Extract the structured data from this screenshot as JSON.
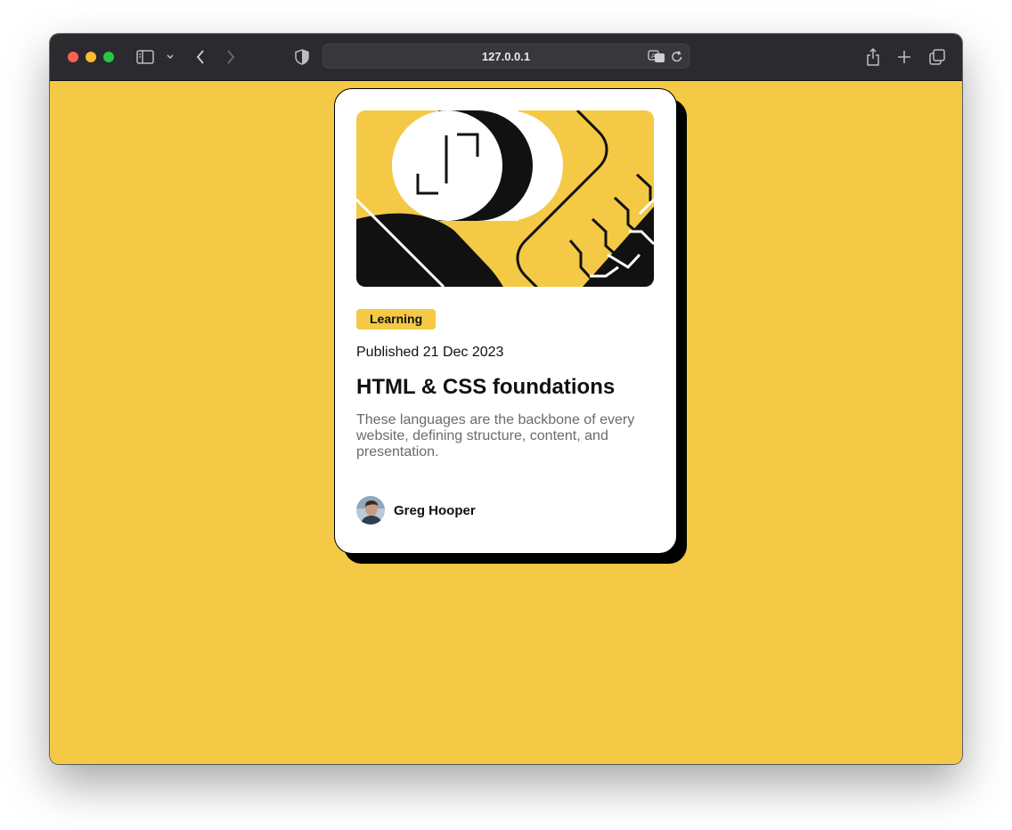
{
  "browser": {
    "url": "127.0.0.1"
  },
  "card": {
    "category": "Learning",
    "published": "Published 21 Dec 2023",
    "title": "HTML & CSS foundations",
    "description": "These languages are the backbone of every website, defining structure, content, and presentation.",
    "author": "Greg Hooper"
  },
  "colors": {
    "page_background": "#f4c945",
    "card_background": "#ffffff",
    "text_dark": "#111111",
    "text_muted": "#6b6b6b",
    "toolbar": "#2b2a2e"
  },
  "icons": {
    "toolbar_left": [
      "sidebar-icon",
      "chevron-down-icon",
      "back-icon",
      "forward-icon",
      "privacy-shield-icon"
    ],
    "toolbar_right": [
      "share-icon",
      "new-tab-icon",
      "tabs-overview-icon"
    ],
    "address_bar": [
      "translate-icon",
      "reload-icon"
    ]
  }
}
